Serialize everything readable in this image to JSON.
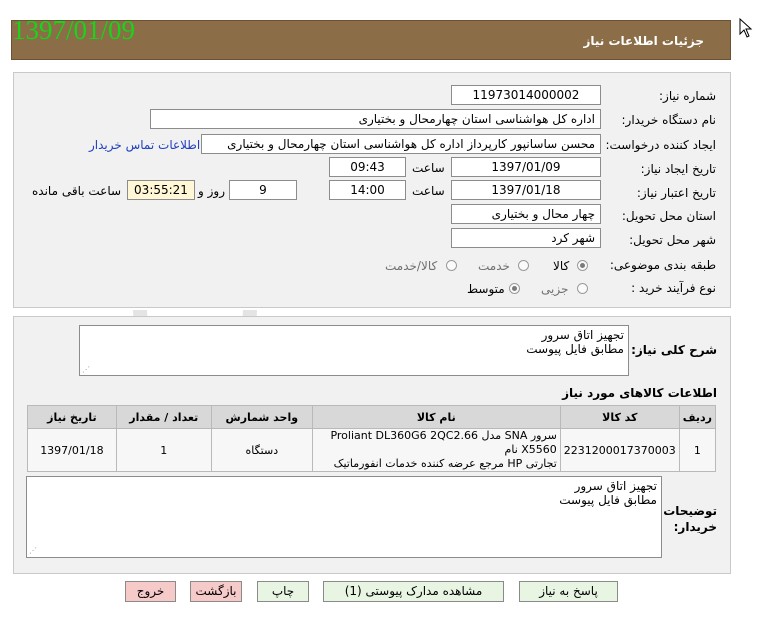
{
  "header": {
    "title": "جزئیات اطلاعات نیاز",
    "date_stamp": "1397/01/09"
  },
  "form": {
    "need_number_label": "شماره نیاز:",
    "need_number": "11973014000002",
    "buyer_org_label": "نام دستگاه خریدار:",
    "buyer_org": "اداره کل هواشناسی استان چهارمحال و بختیاری",
    "requester_label": "ایجاد کننده درخواست:",
    "requester": "محسن ساسانپور کارپرداز اداره کل هواشناسی استان چهارمحال و بختیاری",
    "contact_link": "اطلاعات تماس خریدار",
    "created_label": "تاریخ ایجاد نیاز:",
    "created_date": "1397/01/09",
    "time_label": "ساعت",
    "created_time": "09:43",
    "validity_label": "تاریخ اعتبار نیاز:",
    "validity_date": "1397/01/18",
    "validity_time": "14:00",
    "days": "9",
    "days_label": "روز و",
    "remaining_time": "03:55:21",
    "remaining_label": "ساعت باقی مانده",
    "province_label": "استان محل تحویل:",
    "province": "چهار محال و بختیاری",
    "city_label": "شهر محل تحویل:",
    "city": "شهر کرد",
    "category_label": "طبقه بندی موضوعی:",
    "category_options": [
      "کالا",
      "خدمت",
      "کالا/خدمت"
    ],
    "process_label": "نوع فرآیند خرید :",
    "process_options": [
      "جزیی",
      "متوسط"
    ]
  },
  "summary": {
    "label": "شرح کلی نیاز:",
    "line1": "تجهیز اتاق سرور",
    "line2": "مطابق فایل پیوست"
  },
  "goods": {
    "title": "اطلاعات کالاهای مورد نیاز",
    "columns": [
      "ردیف",
      "کد کالا",
      "نام کالا",
      "واحد شمارش",
      "تعداد / مقدار",
      "تاریخ نیاز"
    ],
    "rows": [
      {
        "row": "1",
        "code": "2231200017370003",
        "name1": "سرور SNA مدل Proliant DL360G6 2QC2.66 X5560 نام",
        "name2": "تجارتی HP مرجع عرضه کننده خدمات انفورماتیک",
        "unit": "دستگاه",
        "qty": "1",
        "date": "1397/01/18"
      }
    ]
  },
  "notes": {
    "label": "توضیحات خریدار:",
    "line1": "تجهیز اتاق سرور",
    "line2": "مطابق فایل پیوست"
  },
  "buttons": {
    "reply": "پاسخ به نیاز",
    "attachments": "مشاهده مدارک پیوستی (1)",
    "print": "چاپ",
    "back": "بازگشت",
    "exit": "خروج"
  }
}
